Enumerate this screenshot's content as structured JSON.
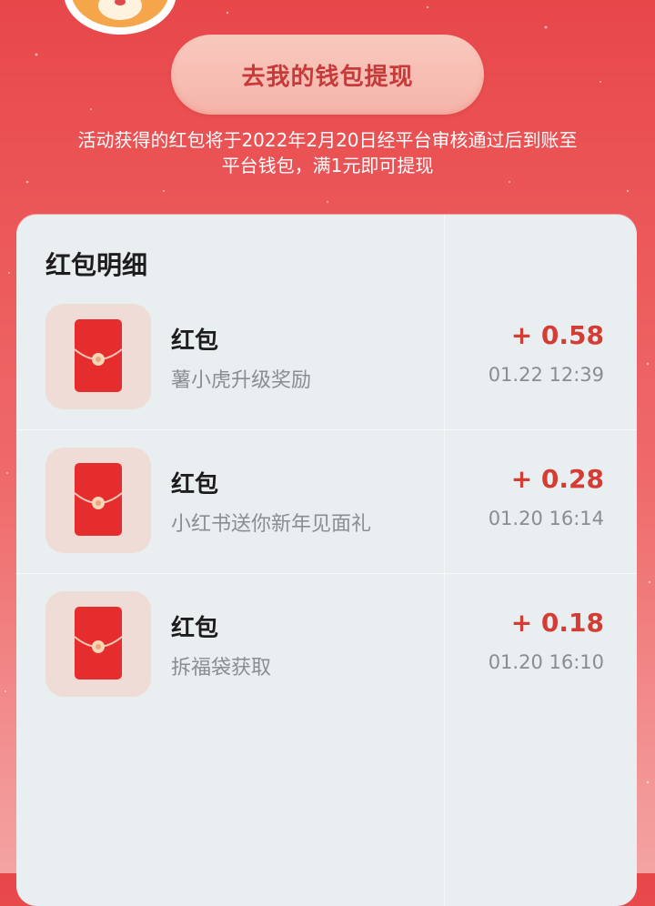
{
  "header": {
    "withdraw_label": "去我的钱包提现",
    "notice_line1": "活动获得的红包将于2022年2月20日经平台审核通过后到账至",
    "notice_line2": "平台钱包，满1元即可提现"
  },
  "detail": {
    "title": "红包明细",
    "items": [
      {
        "name": "红包",
        "desc": "薯小虎升级奖励",
        "amount": "+ 0.58",
        "time": "01.22 12:39"
      },
      {
        "name": "红包",
        "desc": "小红书送你新年见面礼",
        "amount": "+ 0.28",
        "time": "01.20 16:14"
      },
      {
        "name": "红包",
        "desc": "拆福袋获取",
        "amount": "+ 0.18",
        "time": "01.20 16:10"
      }
    ]
  },
  "colors": {
    "background_top": "#e8474a",
    "accent_red": "#d43c34",
    "button_text": "#c73a3a",
    "card_bg": "#e9eef1"
  },
  "icons": {
    "mascot": "tiger-mascot-icon",
    "red_envelope": "red-envelope-icon"
  }
}
